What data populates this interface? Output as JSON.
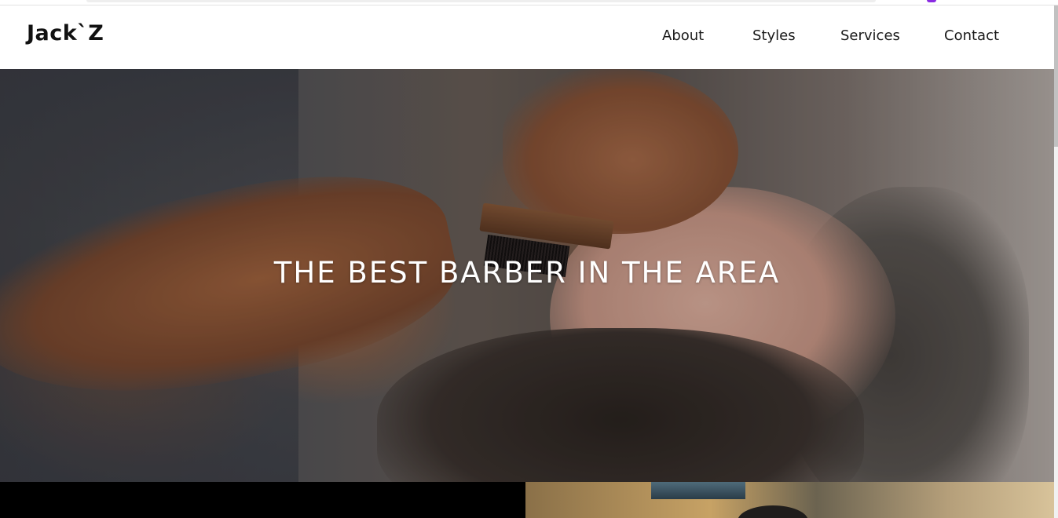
{
  "site": {
    "logo": "Jack`Z"
  },
  "nav": {
    "items": [
      {
        "label": "About"
      },
      {
        "label": "Styles"
      },
      {
        "label": "Services"
      },
      {
        "label": "Contact"
      }
    ]
  },
  "hero": {
    "title": "THE BEST BARBER IN THE AREA"
  },
  "colors": {
    "header_bg": "#ffffff",
    "text_dark": "#111111",
    "hero_text": "#ffffff",
    "bottom_left_bg": "#000000"
  }
}
